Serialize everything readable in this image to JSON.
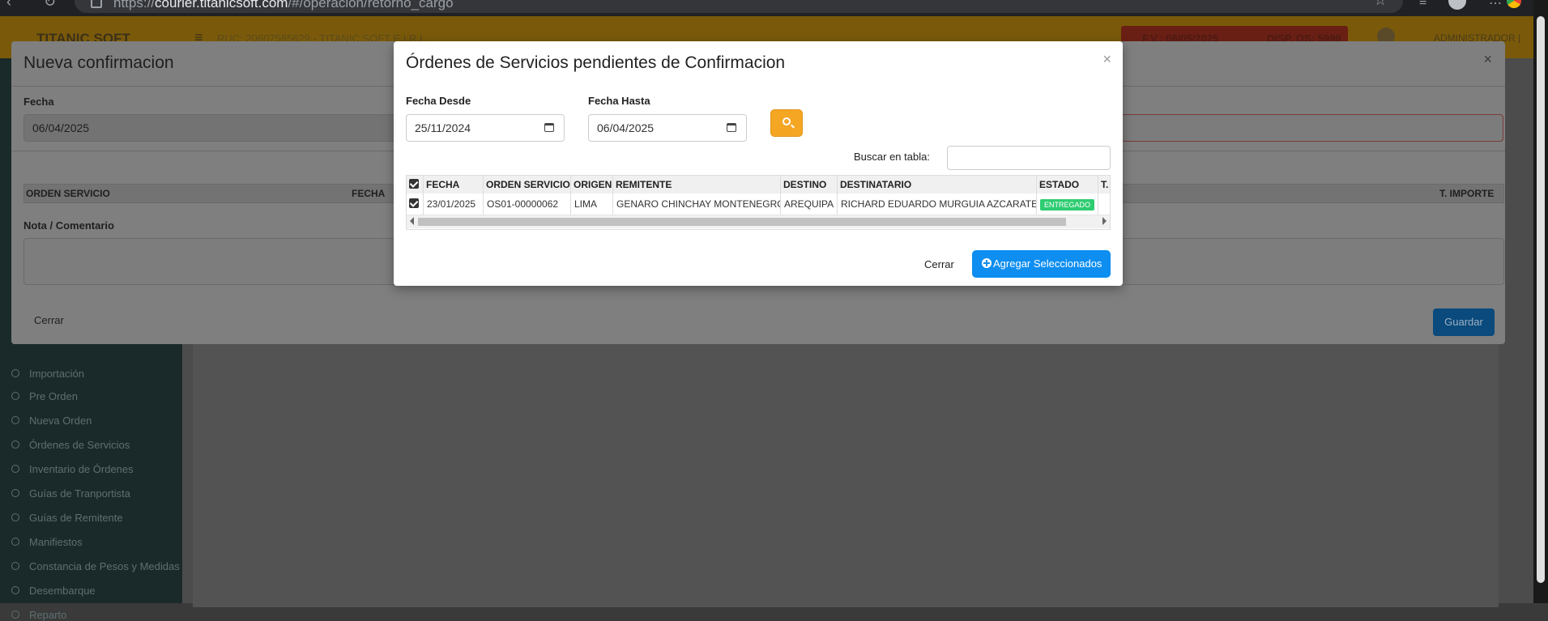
{
  "browser": {
    "url_scheme": "https://",
    "url_host": "courier.titanicsoft.com",
    "url_path": "/#/operacion/retorno_cargo"
  },
  "app": {
    "brand": "TITANIC SOFT",
    "ruc": "RUC: 20607585629 - TITANIC SOFT E.I.R.L.",
    "fv": "F.V.: 06/05/2025",
    "disp_os": "DISP. OS: 5999",
    "user": "ADMINISTRADOR |",
    "sidebar_items": [
      "Importación",
      "Pre Orden",
      "Nueva Orden",
      "Órdenes de Servicios",
      "Inventario de Órdenes",
      "Guías de Tranportista",
      "Guías de Remitente",
      "Manifiestos",
      "Constancia de Pesos y Medidas",
      "Desembarque",
      "Reparto"
    ]
  },
  "back_modal": {
    "title": "Nueva confirmacion",
    "close": "×",
    "fecha_label": "Fecha",
    "fecha_value": "06/04/2025",
    "columns": [
      "ORDEN SERVICIO",
      "FECHA",
      "T. IMPORTE"
    ],
    "nota_label": "Nota / Comentario",
    "cerrar": "Cerrar",
    "guardar": "Guardar"
  },
  "front_modal": {
    "title": "Órdenes de Servicios pendientes de Confirmacion",
    "close": "×",
    "fecha_desde_label": "Fecha Desde",
    "fecha_desde_value": "25/11/2024",
    "fecha_hasta_label": "Fecha Hasta",
    "fecha_hasta_value": "06/04/2025",
    "buscar_label": "Buscar en tabla:",
    "buscar_value": "",
    "table": {
      "headers": [
        "FECHA",
        "ORDEN SERVICIO",
        "ORIGEN",
        "REMITENTE",
        "DESTINO",
        "DESTINATARIO",
        "ESTADO",
        "T."
      ],
      "rows": [
        {
          "checked": true,
          "fecha": "23/01/2025",
          "orden": "OS01-00000062",
          "origen": "LIMA",
          "remitente": "GENARO CHINCHAY MONTENEGRO",
          "destino": "AREQUIPA",
          "destinatario": "RICHARD EDUARDO MURGUIA AZCARATE",
          "estado": "ENTREGADO"
        }
      ]
    },
    "cerrar": "Cerrar",
    "agregar": "Agregar Seleccionados"
  },
  "colors": {
    "search_button": "#f5a623",
    "primary_button": "#0d8ef0",
    "estado_badge": "#2ecc71"
  }
}
